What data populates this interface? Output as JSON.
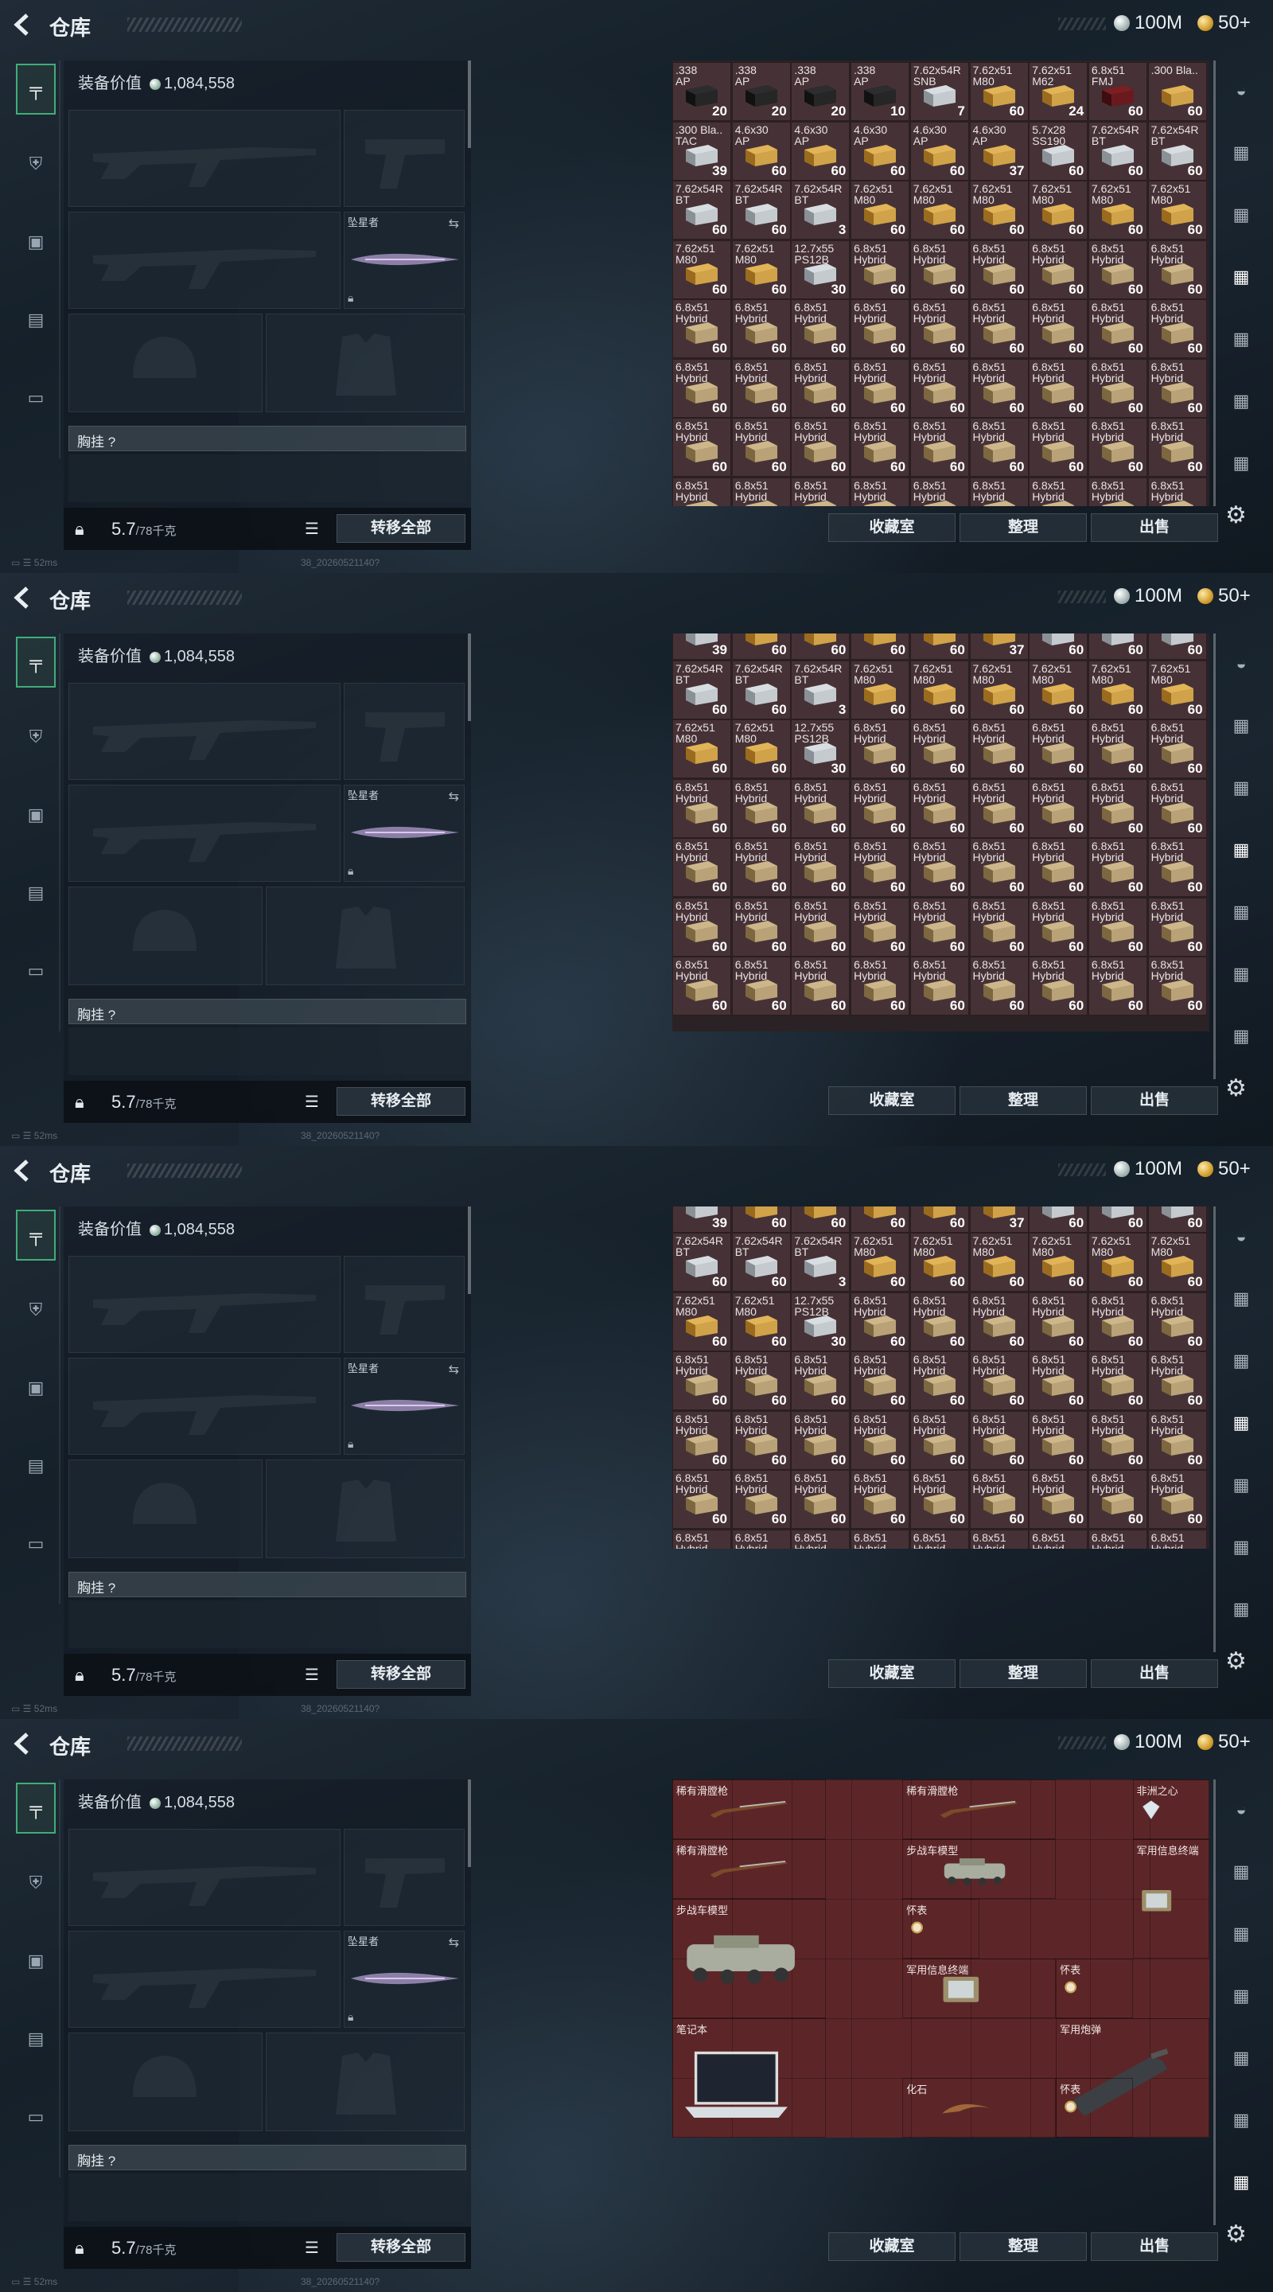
{
  "header": {
    "title": "仓库",
    "silver_amount": "100M",
    "gold_amount": "50+"
  },
  "sidebar": {
    "tabs": [
      {
        "icon": "gun-icon"
      },
      {
        "icon": "armor-icon"
      },
      {
        "icon": "backpack-icon"
      },
      {
        "icon": "clipboard-icon"
      },
      {
        "icon": "briefcase-icon"
      }
    ]
  },
  "equipment": {
    "value_label": "装备价值",
    "value": "1,084,558",
    "melee_label": "坠星者",
    "chest_label": "胸挂 ?",
    "weight_value": "5.7",
    "weight_max": "/78千克",
    "transfer_all": "转移全部"
  },
  "status": {
    "ping": "52ms",
    "build": "38_20260521140?"
  },
  "buttons": {
    "vault": "收藏室",
    "sort": "整理",
    "sell": "出售"
  },
  "colors": {
    "cell_bg": "#463236",
    "collection_bg": "#5c2628",
    "active_tab": "#3fae7a"
  },
  "stash_rows": [
    [
      [
        ".338\nAP",
        "20",
        "black"
      ],
      [
        ".338\nAP",
        "20",
        "black"
      ],
      [
        ".338\nAP",
        "20",
        "black"
      ],
      [
        ".338\nAP",
        "10",
        "black"
      ],
      [
        "7.62x54R\nSNB",
        "7",
        "silver"
      ],
      [
        "7.62x51\nM80",
        "60",
        "gold"
      ],
      [
        "7.62x51\nM62",
        "24",
        "gold"
      ],
      [
        "6.8x51\nFMJ",
        "60",
        "red"
      ],
      [
        ".300 Bla..",
        "60",
        "gold"
      ]
    ],
    [
      [
        ".300 Bla..\nTAC",
        "39",
        "silver"
      ],
      [
        "4.6x30\nAP",
        "60",
        "gold"
      ],
      [
        "4.6x30\nAP",
        "60",
        "gold"
      ],
      [
        "4.6x30\nAP",
        "60",
        "gold"
      ],
      [
        "4.6x30\nAP",
        "60",
        "gold"
      ],
      [
        "4.6x30\nAP",
        "37",
        "gold"
      ],
      [
        "5.7x28\nSS190",
        "60",
        "silver"
      ],
      [
        "7.62x54R\nBT",
        "60",
        "silver"
      ],
      [
        "7.62x54R\nBT",
        "60",
        "silver"
      ]
    ],
    [
      [
        "7.62x54R\nBT",
        "60",
        "silver"
      ],
      [
        "7.62x54R\nBT",
        "60",
        "silver"
      ],
      [
        "7.62x54R\nBT",
        "3",
        "silver"
      ],
      [
        "7.62x51\nM80",
        "60",
        "gold"
      ],
      [
        "7.62x51\nM80",
        "60",
        "gold"
      ],
      [
        "7.62x51\nM80",
        "60",
        "gold"
      ],
      [
        "7.62x51\nM80",
        "60",
        "gold"
      ],
      [
        "7.62x51\nM80",
        "60",
        "gold"
      ],
      [
        "7.62x51\nM80",
        "60",
        "gold"
      ]
    ],
    [
      [
        "7.62x51\nM80",
        "60",
        "gold"
      ],
      [
        "7.62x51\nM80",
        "60",
        "gold"
      ],
      [
        "12.7x55\nPS12B",
        "30",
        "silver"
      ],
      [
        "6.8x51\nHybrid",
        "60",
        "tan"
      ],
      [
        "6.8x51\nHybrid",
        "60",
        "tan"
      ],
      [
        "6.8x51\nHybrid",
        "60",
        "tan"
      ],
      [
        "6.8x51\nHybrid",
        "60",
        "tan"
      ],
      [
        "6.8x51\nHybrid",
        "60",
        "tan"
      ],
      [
        "6.8x51\nHybrid",
        "60",
        "tan"
      ]
    ],
    [
      [
        "6.8x51\nHybrid",
        "60",
        "tan"
      ],
      [
        "6.8x51\nHybrid",
        "60",
        "tan"
      ],
      [
        "6.8x51\nHybrid",
        "60",
        "tan"
      ],
      [
        "6.8x51\nHybrid",
        "60",
        "tan"
      ],
      [
        "6.8x51\nHybrid",
        "60",
        "tan"
      ],
      [
        "6.8x51\nHybrid",
        "60",
        "tan"
      ],
      [
        "6.8x51\nHybrid",
        "60",
        "tan"
      ],
      [
        "6.8x51\nHybrid",
        "60",
        "tan"
      ],
      [
        "6.8x51\nHybrid",
        "60",
        "tan"
      ]
    ],
    [
      [
        "6.8x51\nHybrid",
        "60",
        "tan"
      ],
      [
        "6.8x51\nHybrid",
        "60",
        "tan"
      ],
      [
        "6.8x51\nHybrid",
        "60",
        "tan"
      ],
      [
        "6.8x51\nHybrid",
        "60",
        "tan"
      ],
      [
        "6.8x51\nHybrid",
        "60",
        "tan"
      ],
      [
        "6.8x51\nHybrid",
        "60",
        "tan"
      ],
      [
        "6.8x51\nHybrid",
        "60",
        "tan"
      ],
      [
        "6.8x51\nHybrid",
        "60",
        "tan"
      ],
      [
        "6.8x51\nHybrid",
        "60",
        "tan"
      ]
    ],
    [
      [
        "6.8x51\nHybrid",
        "60",
        "tan"
      ],
      [
        "6.8x51\nHybrid",
        "60",
        "tan"
      ],
      [
        "6.8x51\nHybrid",
        "60",
        "tan"
      ],
      [
        "6.8x51\nHybrid",
        "60",
        "tan"
      ],
      [
        "6.8x51\nHybrid",
        "60",
        "tan"
      ],
      [
        "6.8x51\nHybrid",
        "60",
        "tan"
      ],
      [
        "6.8x51\nHybrid",
        "60",
        "tan"
      ],
      [
        "6.8x51\nHybrid",
        "60",
        "tan"
      ],
      [
        "6.8x51\nHybrid",
        "60",
        "tan"
      ]
    ],
    [
      [
        "6.8x51\nHybrid",
        "60",
        "tan"
      ],
      [
        "6.8x51\nHybrid",
        "60",
        "tan"
      ],
      [
        "6.8x51\nHybrid",
        "60",
        "tan"
      ],
      [
        "6.8x51\nHybrid",
        "60",
        "tan"
      ],
      [
        "6.8x51\nHybrid",
        "60",
        "tan"
      ],
      [
        "6.8x51\nHybrid",
        "60",
        "tan"
      ],
      [
        "6.8x51\nHybrid",
        "60",
        "tan"
      ],
      [
        "6.8x51\nHybrid",
        "60",
        "tan"
      ],
      [
        "6.8x51\nHybrid",
        "60",
        "tan"
      ]
    ]
  ],
  "collection_items": [
    {
      "name": "稀有滑膛枪",
      "icon": "musket"
    },
    {
      "name": "稀有滑膛枪",
      "icon": "musket"
    },
    {
      "name": "非洲之心",
      "icon": "diamond"
    },
    {
      "name": "稀有滑膛枪",
      "icon": "musket"
    },
    {
      "name": "步战车模型",
      "icon": "ifv"
    },
    {
      "name": "军用信息终端",
      "icon": "terminal"
    },
    {
      "name": "步战车模型",
      "icon": "ifv"
    },
    {
      "name": "怀表",
      "icon": "watch"
    },
    {
      "name": "军用信息终端",
      "icon": "terminal"
    },
    {
      "name": "怀表",
      "icon": "watch"
    },
    {
      "name": "军用炮弹",
      "icon": "shell"
    },
    {
      "name": "笔记本",
      "icon": "laptop"
    },
    {
      "name": "化石",
      "icon": "fossil"
    },
    {
      "name": "怀表",
      "icon": "watch"
    }
  ]
}
